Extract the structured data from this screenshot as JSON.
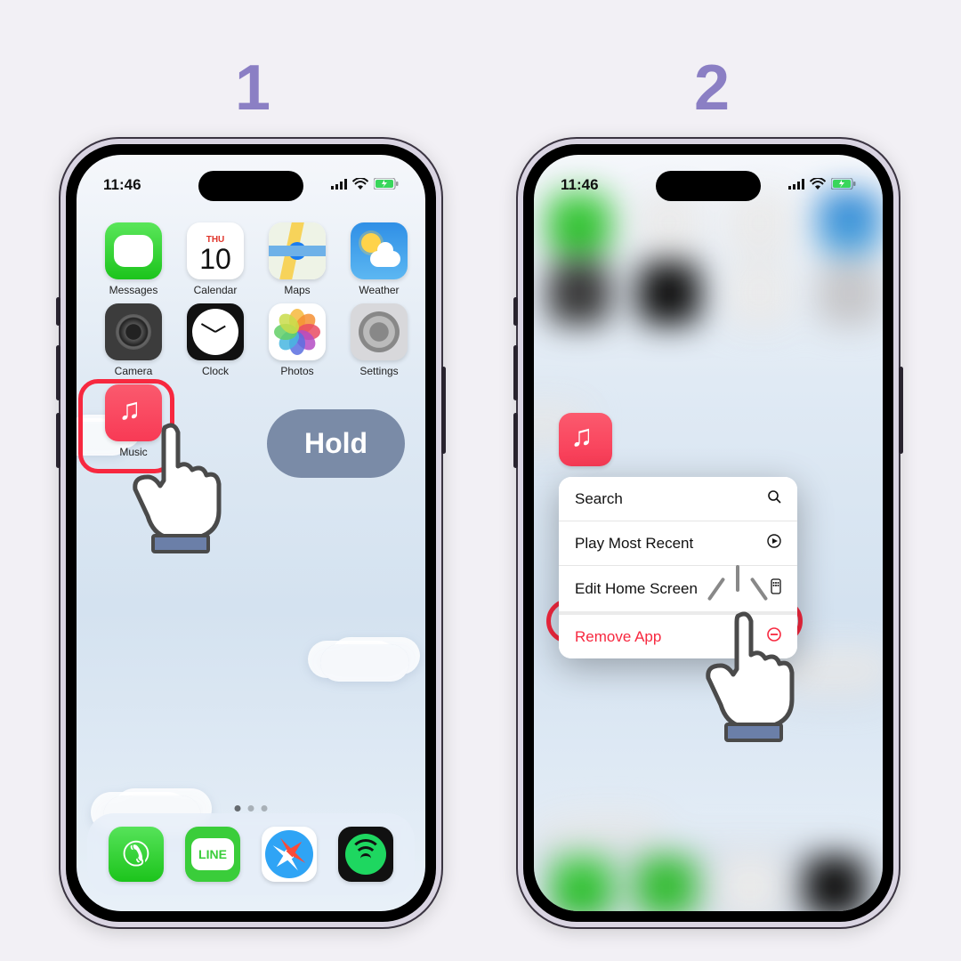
{
  "steps": {
    "one": "1",
    "two": "2"
  },
  "status": {
    "time": "11:46"
  },
  "apps": {
    "row1": [
      {
        "label": "Messages",
        "icon": "messages"
      },
      {
        "label": "Calendar",
        "icon": "calendar",
        "dow": "THU",
        "day": "10"
      },
      {
        "label": "Maps",
        "icon": "maps"
      },
      {
        "label": "Weather",
        "icon": "weather"
      }
    ],
    "row2": [
      {
        "label": "Camera",
        "icon": "camera"
      },
      {
        "label": "Clock",
        "icon": "clock"
      },
      {
        "label": "Photos",
        "icon": "photos"
      },
      {
        "label": "Settings",
        "icon": "settings"
      }
    ],
    "row3": [
      {
        "label": "Music",
        "icon": "music"
      }
    ],
    "dock": [
      {
        "icon": "phone"
      },
      {
        "icon": "line",
        "text": "LINE"
      },
      {
        "icon": "safari"
      },
      {
        "icon": "spotify"
      }
    ]
  },
  "annotation": {
    "hold": "Hold"
  },
  "context_menu": {
    "items": [
      {
        "label": "Search",
        "iconName": "search-icon"
      },
      {
        "label": "Play Most Recent",
        "iconName": "play-icon"
      },
      {
        "label": "Edit Home Screen",
        "iconName": "homescreen-icon"
      },
      {
        "label": "Remove App",
        "iconName": "remove-icon"
      }
    ]
  },
  "colors": {
    "highlight": "#f7283f",
    "step": "#8b7fc4"
  }
}
